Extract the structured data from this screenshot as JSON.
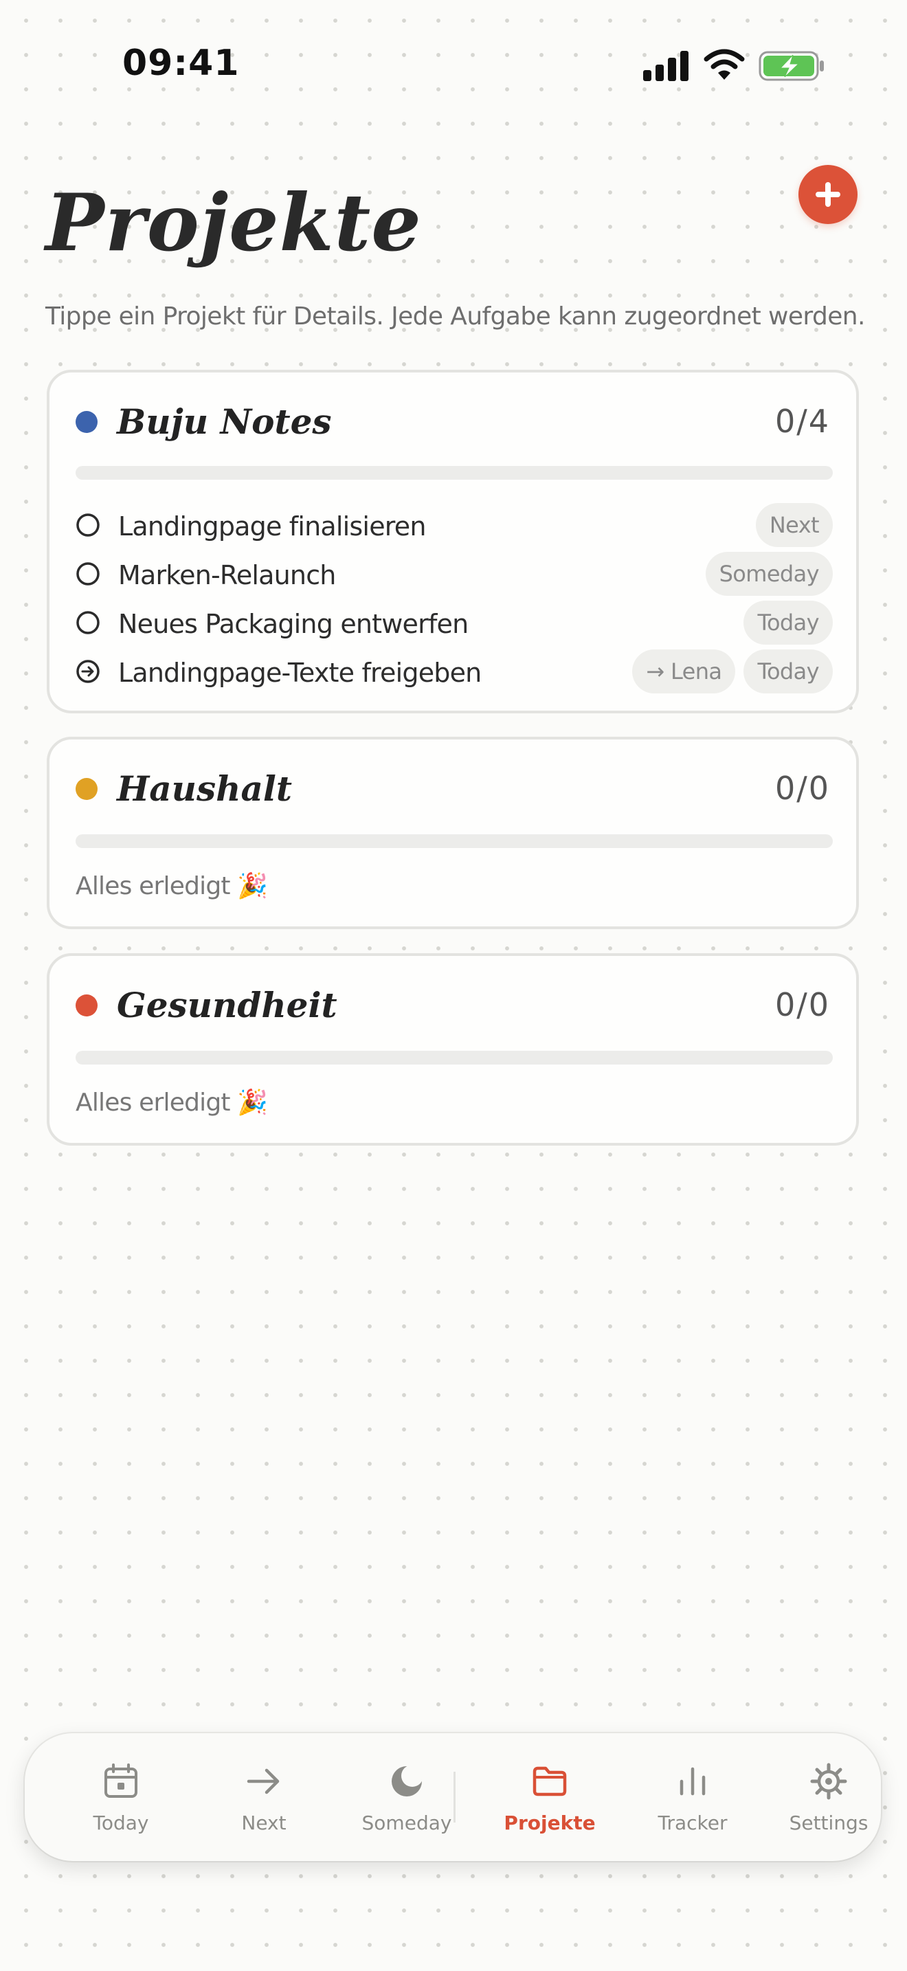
{
  "status_bar": {
    "time": "09:41"
  },
  "header": {
    "title": "Projekte",
    "subtitle": "Tippe ein Projekt für Details. Jede Aufgabe kann zugeordnet werden."
  },
  "projects": [
    {
      "name": "Buju Notes",
      "color": "#3c63ad",
      "count": "0/4",
      "progress": 0,
      "tasks": [
        {
          "label": "Landingpage finalisieren",
          "tags": [
            "Next"
          ]
        },
        {
          "label": "Marken-Relaunch",
          "tags": [
            "Someday"
          ]
        },
        {
          "label": "Neues Packaging entwerfen",
          "tags": [
            "Today"
          ]
        },
        {
          "label": "Landingpage-Texte freigeben",
          "tags": [
            "→ Lena",
            "Today"
          ],
          "delegated": true
        }
      ]
    },
    {
      "name": "Haushalt",
      "color": "#e0a124",
      "count": "0/0",
      "progress": 0,
      "empty_text": "Alles erledigt 🎉"
    },
    {
      "name": "Gesundheit",
      "color": "#dc5238",
      "count": "0/0",
      "progress": 0,
      "empty_text": "Alles erledigt 🎉"
    }
  ],
  "tab_bar": {
    "active": "Projekte",
    "active_color": "#d95036",
    "tabs": [
      {
        "label": "Today",
        "icon": "calendar-icon"
      },
      {
        "label": "Next",
        "icon": "arrow-right-icon"
      },
      {
        "label": "Someday",
        "icon": "moon-icon"
      },
      {
        "label": "Projekte",
        "icon": "folder-icon"
      },
      {
        "label": "Tracker",
        "icon": "bar-chart-icon"
      },
      {
        "label": "Settings",
        "icon": "gear-icon"
      }
    ]
  }
}
